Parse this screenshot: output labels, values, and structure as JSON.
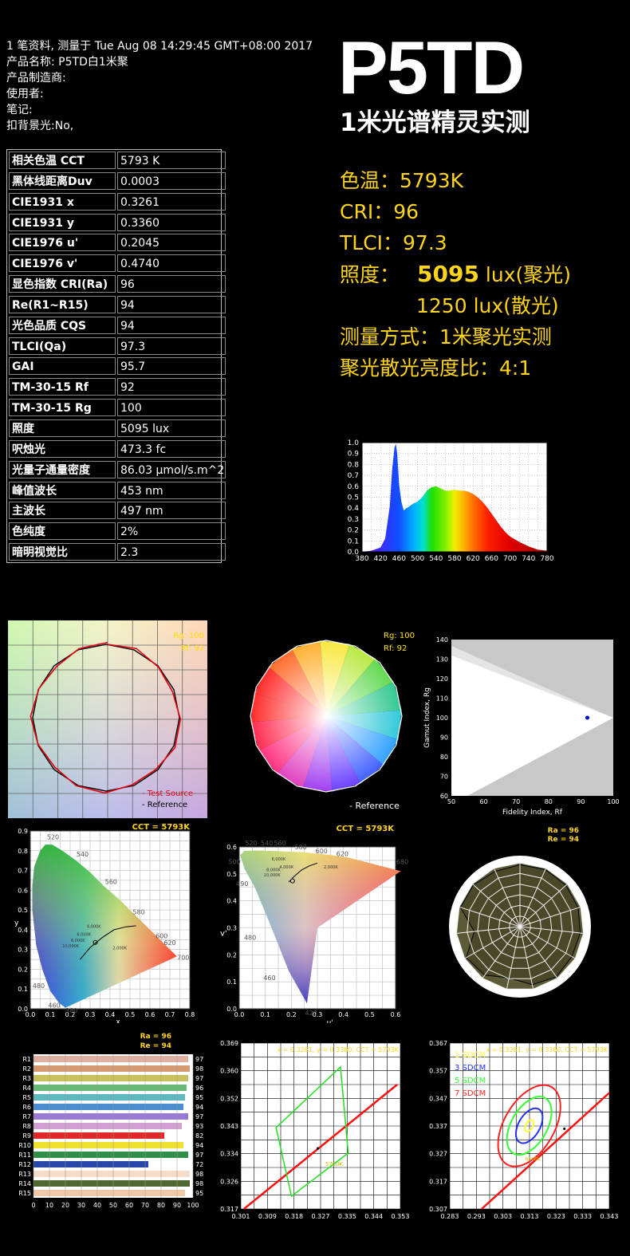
{
  "info": {
    "lines": [
      "1 笔资料, 测量于 Tue Aug 08 14:29:45 GMT+08:00 2017",
      "产品名称: P5TD白1米聚",
      "产品制造商:",
      "使用者:",
      "笔记:",
      "扣背景光:No,"
    ]
  },
  "brand": {
    "title": "P5TD",
    "subtitle": "1米光谱精灵实测"
  },
  "summary": {
    "cct": "色温：5793K",
    "cri": "CRI：96",
    "tlci": "TLCI：97.3",
    "lux_label": "照度：",
    "lux_spot_value": "5095",
    "lux_spot_unit": " lux(聚光)",
    "lux_flood": "1250 lux(散光)",
    "method": "测量方式：1米聚光实测",
    "ratio": "聚光散光亮度比：4:1"
  },
  "spec_table": [
    {
      "label": "相关色温 CCT",
      "value": "5793 K"
    },
    {
      "label": "黑体线距离Duv",
      "value": "0.0003"
    },
    {
      "label": "CIE1931 x",
      "value": "0.3261"
    },
    {
      "label": "CIE1931 y",
      "value": "0.3360"
    },
    {
      "label": "CIE1976 u'",
      "value": "0.2045"
    },
    {
      "label": "CIE1976 v'",
      "value": "0.4740"
    },
    {
      "label": "显色指数 CRI(Ra)",
      "value": "96"
    },
    {
      "label": "Re(R1~R15)",
      "value": "94"
    },
    {
      "label": "光色品质 CQS",
      "value": "94"
    },
    {
      "label": "TLCI(Qa)",
      "value": "97.3"
    },
    {
      "label": "GAI",
      "value": "95.7"
    },
    {
      "label": "TM-30-15 Rf",
      "value": "92"
    },
    {
      "label": "TM-30-15 Rg",
      "value": "100"
    },
    {
      "label": "照度",
      "value": "5095 lux"
    },
    {
      "label": "呎烛光",
      "value": "473.3 fc"
    },
    {
      "label": "光量子通量密度",
      "value": "86.03 μmol/s.m^2"
    },
    {
      "label": "峰值波长",
      "value": "453 nm"
    },
    {
      "label": "主波长",
      "value": "497 nm"
    },
    {
      "label": "色纯度",
      "value": "2%"
    },
    {
      "label": "暗明视觉比",
      "value": "2.3"
    }
  ],
  "chart_data": [
    {
      "type": "area",
      "x": [
        380,
        400,
        420,
        430,
        440,
        445,
        450,
        453,
        456,
        460,
        465,
        470,
        480,
        490,
        500,
        510,
        520,
        530,
        540,
        550,
        560,
        570,
        580,
        590,
        600,
        610,
        620,
        630,
        640,
        650,
        660,
        670,
        680,
        690,
        700,
        720,
        740,
        760,
        780
      ],
      "y": [
        0.0,
        0.01,
        0.04,
        0.12,
        0.42,
        0.75,
        0.95,
        0.99,
        0.9,
        0.62,
        0.46,
        0.38,
        0.41,
        0.44,
        0.46,
        0.5,
        0.56,
        0.59,
        0.6,
        0.58,
        0.56,
        0.56,
        0.57,
        0.56,
        0.56,
        0.55,
        0.53,
        0.5,
        0.46,
        0.41,
        0.35,
        0.29,
        0.23,
        0.18,
        0.14,
        0.09,
        0.05,
        0.02,
        0.01
      ],
      "xticks": [
        "380",
        "420",
        "460",
        "500",
        "540",
        "580",
        "620",
        "660",
        "700",
        "740",
        "780"
      ],
      "yticks": [
        "0.0",
        "0.1",
        "0.2",
        "0.3",
        "0.4",
        "0.5",
        "0.6",
        "0.7",
        "0.8",
        "0.9",
        "1.0"
      ],
      "xlim": [
        380,
        780
      ],
      "ylim": [
        0,
        1
      ]
    },
    {
      "type": "line",
      "legend": [
        "- Test Source",
        "- Reference"
      ],
      "labels": [
        "Rg: 100",
        "Rf: 92"
      ]
    },
    {
      "type": "pie",
      "labels": [
        "Rg: 100",
        "Rf: 92"
      ],
      "legend": [
        "- Reference"
      ]
    },
    {
      "type": "scatter",
      "xlabel": "Fidelity Index, Rf",
      "ylabel": "Gamut Index, Rg",
      "xticks": [
        "50",
        "60",
        "70",
        "80",
        "90",
        "100"
      ],
      "yticks": [
        "60",
        "70",
        "80",
        "90",
        "100",
        "110",
        "120",
        "130",
        "140"
      ],
      "xlim": [
        50,
        100
      ],
      "ylim": [
        60,
        140
      ],
      "points": [
        {
          "x": 92,
          "y": 100
        }
      ]
    },
    {
      "type": "scatter",
      "title": "CCT = 5793K",
      "xlabel": "x",
      "ylabel": "y",
      "xticks": [
        "0.0",
        "0.1",
        "0.2",
        "0.3",
        "0.4",
        "0.5",
        "0.6",
        "0.7",
        "0.8"
      ],
      "yticks": [
        "0.0",
        "0.1",
        "0.2",
        "0.3",
        "0.4",
        "0.5",
        "0.6",
        "0.7",
        "0.8",
        "0.9"
      ],
      "wavelength_labels": [
        "520",
        "540",
        "560",
        "580",
        "600",
        "620",
        "700",
        "480",
        "460",
        "380"
      ],
      "cct_labels": [
        "10,000K",
        "8,000K",
        "6,000K",
        "4,000K",
        "2,000K"
      ],
      "points": [
        {
          "x": 0.3261,
          "y": 0.336
        }
      ]
    },
    {
      "type": "scatter",
      "title": "CCT = 5793K",
      "xlabel": "u'",
      "ylabel": "v'",
      "xticks": [
        "0.0",
        "0.1",
        "0.2",
        "0.3",
        "0.4",
        "0.5",
        "0.6"
      ],
      "yticks": [
        "0.0",
        "0.1",
        "0.2",
        "0.3",
        "0.4",
        "0.5",
        "0.6"
      ],
      "wavelength_labels": [
        "520",
        "540",
        "560",
        "580",
        "600",
        "620",
        "680",
        "500",
        "490",
        "480",
        "460",
        "420"
      ],
      "cct_labels": [
        "6,000K",
        "4,000K",
        "8,000K",
        "10,000K",
        "2,000K"
      ],
      "points": [
        {
          "x": 0.2045,
          "y": 0.474
        }
      ]
    },
    {
      "type": "line",
      "labels": [
        "Ra = 96",
        "Re = 94"
      ],
      "categories": [
        "R1",
        "R2",
        "R3",
        "R4",
        "R5",
        "R6",
        "R7",
        "R8",
        "R9",
        "R10",
        "R11",
        "R12",
        "R13",
        "R14",
        "R15"
      ],
      "values": [
        97,
        98,
        97,
        96,
        95,
        94,
        97,
        93,
        82,
        94,
        97,
        72,
        98,
        98,
        95
      ]
    },
    {
      "type": "bar",
      "labels": [
        "Ra = 96",
        "Re = 94"
      ],
      "categories": [
        "R1",
        "R2",
        "R3",
        "R4",
        "R5",
        "R6",
        "R7",
        "R8",
        "R9",
        "R10",
        "R11",
        "R12",
        "R13",
        "R14",
        "R15"
      ],
      "values": [
        97,
        98,
        97,
        96,
        95,
        94,
        97,
        93,
        82,
        94,
        97,
        72,
        98,
        98,
        95
      ],
      "colors": [
        "#e0b0a0",
        "#d49a72",
        "#c8c060",
        "#68b878",
        "#5fb8c0",
        "#4a8ed0",
        "#9a7ad0",
        "#d0a0d0",
        "#e02828",
        "#f0e030",
        "#2f8f48",
        "#2848a8",
        "#f4dcc8",
        "#506830",
        "#f0c8a8"
      ],
      "xticks": [
        "0",
        "10",
        "20",
        "30",
        "40",
        "50",
        "60",
        "70",
        "80",
        "90",
        "100"
      ],
      "xlim": [
        0,
        100
      ]
    },
    {
      "type": "scatter",
      "title": "x = 0.3261, y = 0.3360, CCT = 5793K",
      "xticks": [
        "0.301",
        "0.309",
        "0.318",
        "0.327",
        "0.335",
        "0.344",
        "0.353"
      ],
      "yticks": [
        "0.369",
        "0.360",
        "0.352",
        "0.343",
        "0.334",
        "0.326",
        "0.317"
      ],
      "xlim": [
        0.301,
        0.353
      ],
      "ylim": [
        0.317,
        0.369
      ],
      "annotations": [
        "5700K"
      ],
      "points": [
        {
          "x": 0.3261,
          "y": 0.336
        }
      ]
    },
    {
      "type": "scatter",
      "title": "x = 0.3261, y = 0.3360, CCT = 5793K",
      "legend": [
        "1 SDCM",
        "3 SDCM",
        "5 SDCM",
        "7 SDCM"
      ],
      "legend_colors": [
        "#ffff40",
        "#2030ff",
        "#30ff30",
        "#ff2020"
      ],
      "xticks": [
        "0.283",
        "0.293",
        "0.303",
        "0.313",
        "0.323",
        "0.333",
        "0.343"
      ],
      "yticks": [
        "0.367",
        "0.357",
        "0.347",
        "0.337",
        "0.327",
        "0.317",
        "0.307"
      ],
      "xlim": [
        0.283,
        0.343
      ],
      "ylim": [
        0.307,
        0.367
      ],
      "annotations": [
        "6500K"
      ],
      "points": [
        {
          "x": 0.3261,
          "y": 0.336
        }
      ]
    }
  ],
  "colors": {
    "accent": "#ffd51a",
    "text": "#ffffff",
    "background": "#000000"
  }
}
